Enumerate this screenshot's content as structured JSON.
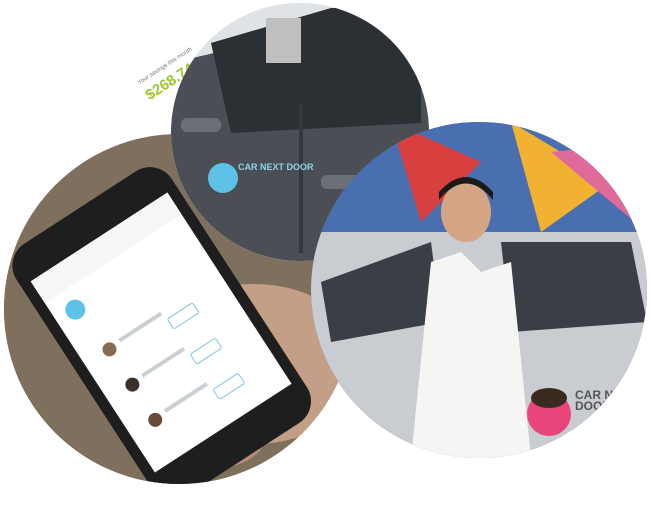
{
  "phone_app": {
    "savings_label": "Your savings this month",
    "savings_amount": "$268.74"
  },
  "car_door_logo": {
    "text": "CAR NEXT DOOR"
  },
  "person_car_logo": {
    "text": "CAR NEXT DOOR"
  },
  "colors": {
    "accent_green": "#9ac92f",
    "brand_blue": "#5ec2e6",
    "brand_pink": "#e8457a"
  }
}
